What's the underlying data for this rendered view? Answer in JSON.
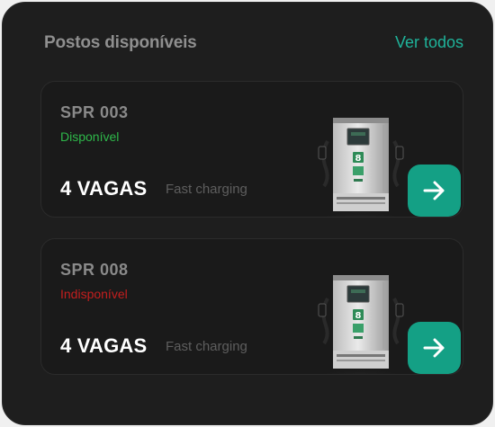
{
  "header": {
    "title": "Postos disponíveis",
    "see_all": "Ver todos"
  },
  "stations": [
    {
      "id": "SPR 003",
      "status": "Disponível",
      "status_color": "#2eb84a",
      "spots": "4 VAGAS",
      "charge_type": "Fast charging"
    },
    {
      "id": "SPR 008",
      "status": "Indisponível",
      "status_color": "#c41e1e",
      "spots": "4 VAGAS",
      "charge_type": "Fast charging"
    }
  ],
  "colors": {
    "accent": "#14a085",
    "link": "#1fb39a",
    "background": "#1e1e1e"
  },
  "icons": {
    "go_button": "arrow-right-icon",
    "station_image": "ev-charger-image"
  }
}
